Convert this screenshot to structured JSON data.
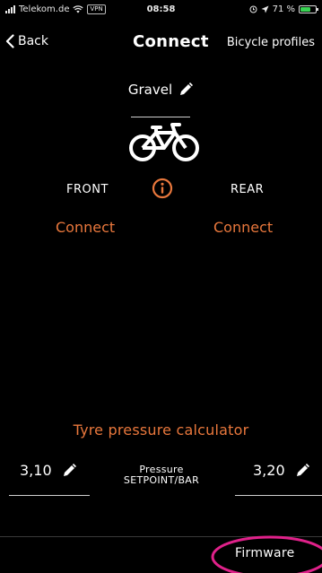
{
  "status_bar": {
    "carrier": "Telekom.de",
    "vpn": "VPN",
    "time": "08:58",
    "battery_percent": "71 %",
    "battery_level": 0.71
  },
  "nav": {
    "back_label": "Back",
    "title": "Connect",
    "right_link": "Bicycle profiles"
  },
  "profile": {
    "name": "Gravel"
  },
  "sensors": {
    "front_label": "FRONT",
    "rear_label": "REAR",
    "front_connect": "Connect",
    "rear_connect": "Connect"
  },
  "calculator": {
    "title": "Tyre pressure calculator",
    "front_value": "3,10",
    "rear_value": "3,20",
    "label_line1": "Pressure",
    "label_line2": "SETPOINT/BAR"
  },
  "footer": {
    "firmware_label": "Firmware"
  },
  "colors": {
    "accent": "#e8773c",
    "highlight": "#e0218a",
    "background": "#000000"
  }
}
